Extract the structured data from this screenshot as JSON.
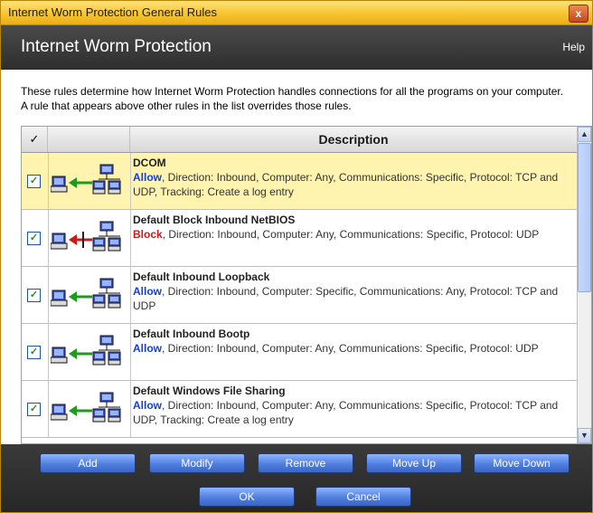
{
  "window": {
    "title": "Internet Worm Protection General Rules",
    "close_glyph": "x"
  },
  "header": {
    "title": "Internet Worm Protection",
    "help_label": "Help"
  },
  "description": "These rules determine how Internet Worm Protection handles connections for all the programs on your computer.  A rule that appears above other rules in the list overrides those rules.",
  "table": {
    "columns": [
      "✓",
      "",
      "Description"
    ],
    "rows": [
      {
        "checked": true,
        "icon": "allow-inbound-icon",
        "name": "DCOM",
        "action": "Allow",
        "details": ", Direction: Inbound, Computer: Any, Communications: Specific, Protocol: TCP and UDP, Tracking: Create a log entry"
      },
      {
        "checked": true,
        "icon": "block-inbound-icon",
        "name": "Default Block Inbound NetBIOS",
        "action": "Block",
        "details": ", Direction: Inbound, Computer: Any, Communications: Specific, Protocol: UDP"
      },
      {
        "checked": true,
        "icon": "allow-inbound-icon",
        "name": "Default Inbound Loopback",
        "action": "Allow",
        "details": ", Direction: Inbound, Computer: Specific, Communications: Any, Protocol: TCP and UDP"
      },
      {
        "checked": true,
        "icon": "allow-inbound-icon",
        "name": "Default Inbound Bootp",
        "action": "Allow",
        "details": ", Direction: Inbound, Computer: Any, Communications: Specific, Protocol: UDP"
      },
      {
        "checked": true,
        "icon": "allow-inbound-icon",
        "name": "Default Windows File Sharing",
        "action": "Allow",
        "details": ", Direction: Inbound, Computer: Any, Communications: Specific, Protocol: TCP and UDP, Tracking: Create a log entry"
      }
    ]
  },
  "buttons": {
    "add": "Add",
    "modify": "Modify",
    "remove": "Remove",
    "move_up": "Move Up",
    "move_down": "Move Down",
    "ok": "OK",
    "cancel": "Cancel"
  },
  "colors": {
    "allow": "#1540d6",
    "block": "#cc1a1a",
    "selected_row": "#fff3b0",
    "title_bar": "#f7c531",
    "button": "#4f7fe0"
  }
}
